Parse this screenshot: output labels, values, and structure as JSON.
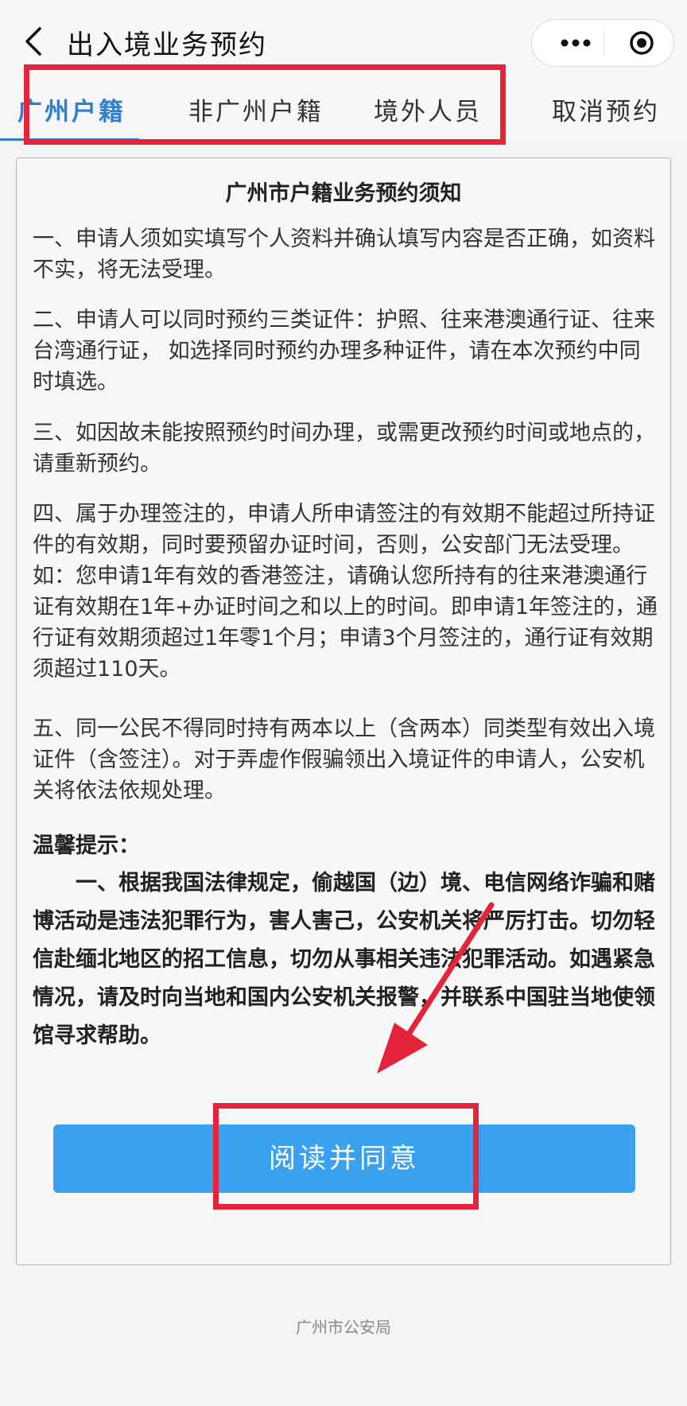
{
  "nav": {
    "title": "出入境业务预约",
    "back_icon": "chevron-left-icon",
    "more_icon": "more-dots-icon",
    "close_icon": "target-circle-icon"
  },
  "tabs": [
    {
      "label": "广州户籍",
      "active": true
    },
    {
      "label": "非广州户籍",
      "active": false
    },
    {
      "label": "境外人员",
      "active": false
    },
    {
      "label": "取消预约",
      "active": false
    }
  ],
  "notice": {
    "title": "广州市户籍业务预约须知",
    "items": [
      "一、申请人须如实填写个人资料并确认填写内容是否正确，如资料不实，将无法受理。",
      "二、申请人可以同时预约三类证件：护照、往来港澳通行证、往来台湾通行证， 如选择同时预约办理多种证件，请在本次预约中同时填选。",
      "三、如因故未能按照预约时间办理，或需更改预约时间或地点的，请重新预约。",
      "四、属于办理签注的，申请人所申请签注的有效期不能超过所持证件的有效期，同时要预留办证时间，否则，公安部门无法受理。如：您申请1年有效的香港签注，请确认您所持有的往来港澳通行证有效期在1年+办证时间之和以上的时间。即申请1年签注的，通行证有效期须超过1年零1个月；申请3个月签注的，通行证有效期须超过110天。",
      "五、同一公民不得同时持有两本以上（含两本）同类型有效出入境证件（含签注）。对于弄虚作假骗领出入境证件的申请人，公安机关将依法依规处理。"
    ],
    "tips_heading": "温馨提示：",
    "tips_body": "一、根据我国法律规定，偷越国（边）境、电信网络诈骗和赌博活动是违法犯罪行为，害人害己，公安机关将严厉打击。切勿轻信赴缅北地区的招工信息，切勿从事相关违法犯罪活动。如遇紧急情况，请及时向当地和国内公安机关报警，并联系中国驻当地使领馆寻求帮助。"
  },
  "agree_button": "阅读并同意",
  "footer": "广州市公安局",
  "colors": {
    "accent": "#2f7fcf",
    "button": "#3aa0f0",
    "annotation": "#e4243a"
  }
}
